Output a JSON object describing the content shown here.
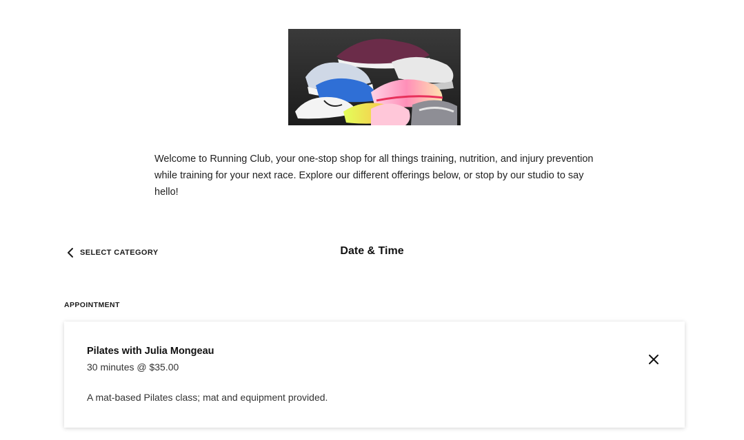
{
  "intro": {
    "text": "Welcome to Running Club, your one-stop shop for all things training, nutrition, and injury prevention while training for your next race. Explore our different offerings below, or stop by our studio to say hello!"
  },
  "nav": {
    "back_label": "SELECT CATEGORY",
    "back_icon": "chevron-left-icon",
    "step_title": "Date & Time"
  },
  "appointment": {
    "section_label": "APPOINTMENT",
    "name": "Pilates with Julia Mongeau",
    "meta": "30 minutes @ $35.00",
    "description": "A mat-based Pilates class; mat and equipment provided.",
    "close_icon": "close-icon"
  },
  "hero": {
    "icon": "running-shoes-photo"
  }
}
